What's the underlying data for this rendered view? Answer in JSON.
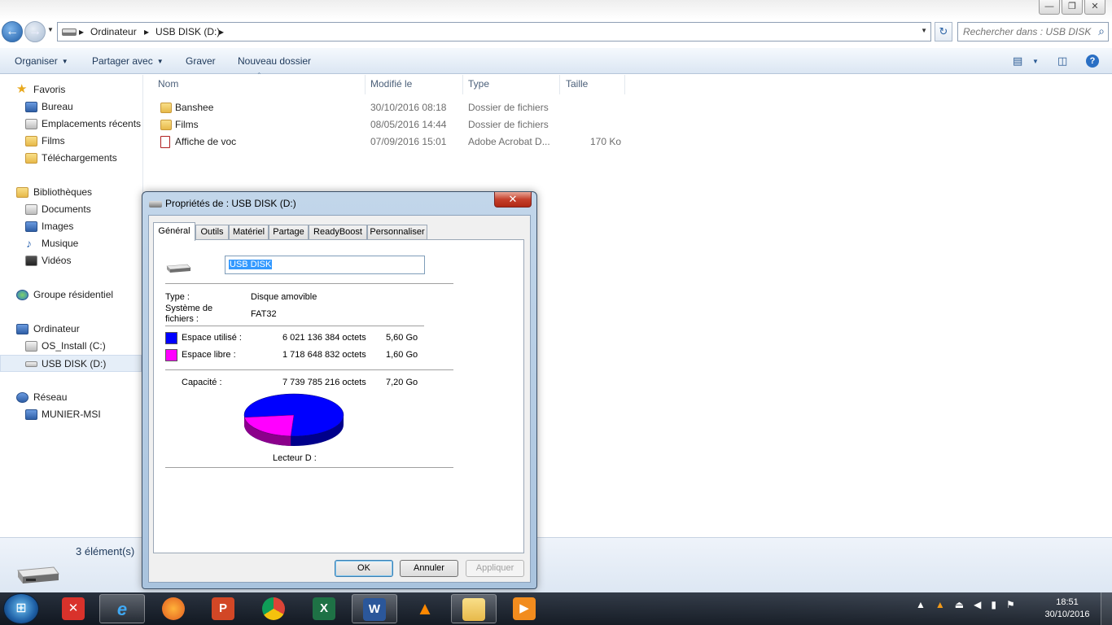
{
  "window": {
    "controls": {
      "minimize": "—",
      "maximize": "❐",
      "close": "✕"
    }
  },
  "address": {
    "crumbs": [
      "Ordinateur",
      "USB DISK (D:)"
    ],
    "separator": "▸",
    "search_placeholder": "Rechercher dans : USB DISK ..."
  },
  "toolbar": {
    "organize": "Organiser",
    "share": "Partager avec",
    "burn": "Graver",
    "new_folder": "Nouveau dossier"
  },
  "sidebar": {
    "favorites": "Favoris",
    "fav_items": [
      "Bureau",
      "Emplacements récents",
      "Films",
      "Téléchargements"
    ],
    "libraries": "Bibliothèques",
    "lib_items": [
      "Documents",
      "Images",
      "Musique",
      "Vidéos"
    ],
    "homegroup": "Groupe résidentiel",
    "computer": "Ordinateur",
    "computer_items": [
      "OS_Install (C:)",
      "USB DISK (D:)"
    ],
    "network": "Réseau",
    "network_items": [
      "MUNIER-MSI"
    ]
  },
  "filelist": {
    "columns": [
      "Nom",
      "Modifié le",
      "Type",
      "Taille"
    ],
    "rows": [
      {
        "name": "Banshee",
        "modified": "30/10/2016 08:18",
        "type": "Dossier de fichiers",
        "size": ""
      },
      {
        "name": "Films",
        "modified": "08/05/2016 14:44",
        "type": "Dossier de fichiers",
        "size": ""
      },
      {
        "name": "Affiche de voc",
        "modified": "07/09/2016 15:01",
        "type": "Adobe Acrobat D...",
        "size": "170 Ko"
      }
    ]
  },
  "status": {
    "count": "3 élément(s)"
  },
  "dialog": {
    "title": "Propriétés de : USB DISK (D:)",
    "close": "✕",
    "tabs": [
      "Général",
      "Outils",
      "Matériel",
      "Partage",
      "ReadyBoost",
      "Personnaliser"
    ],
    "name": "USB DISK",
    "type_label": "Type :",
    "type_value": "Disque amovible",
    "fs_label_1": "Système de",
    "fs_label_2": "fichiers :",
    "fs_value": "FAT32",
    "used_label": "Espace utilisé :",
    "used_bytes": "6 021 136 384 octets",
    "used_size": "5,60 Go",
    "free_label": "Espace libre :",
    "free_bytes": "1 718 648 832 octets",
    "free_size": "1,60 Go",
    "capacity_label": "Capacité :",
    "capacity_bytes": "7 739 785 216 octets",
    "capacity_size": "7,20 Go",
    "drive_label": "Lecteur D :",
    "used_fraction": 0.778,
    "used_color": "#0000ff",
    "free_color": "#ff00ff",
    "buttons": {
      "ok": "OK",
      "cancel": "Annuler",
      "apply": "Appliquer"
    }
  },
  "taskbar": {
    "apps": [
      "xmind-icon",
      "internet-explorer-icon",
      "firefox-icon",
      "powerpoint-icon",
      "chrome-icon",
      "excel-icon",
      "word-icon",
      "vlc-icon",
      "explorer-icon",
      "media-player-icon"
    ],
    "time": "18:51",
    "date": "30/10/2016"
  }
}
